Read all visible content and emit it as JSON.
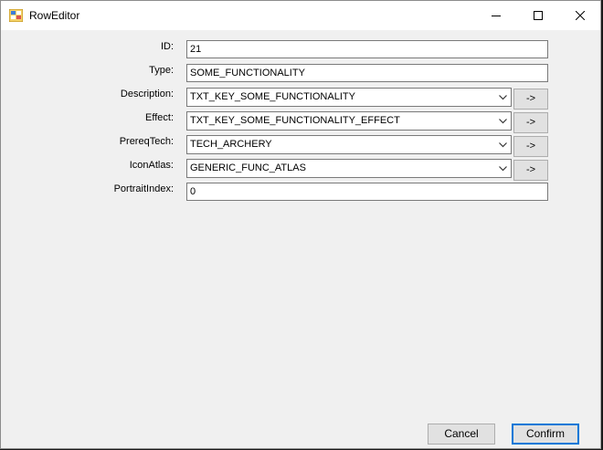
{
  "window": {
    "title": "RowEditor"
  },
  "form": {
    "id": {
      "label": "ID:",
      "value": "21"
    },
    "type": {
      "label": "Type:",
      "value": "SOME_FUNCTIONALITY"
    },
    "description": {
      "label": "Description:",
      "value": "TXT_KEY_SOME_FUNCTIONALITY",
      "go": "->"
    },
    "effect": {
      "label": "Effect:",
      "value": "TXT_KEY_SOME_FUNCTIONALITY_EFFECT",
      "go": "->"
    },
    "prereq_tech": {
      "label": "PrereqTech:",
      "value": "TECH_ARCHERY",
      "go": "->"
    },
    "icon_atlas": {
      "label": "IconAtlas:",
      "value": "GENERIC_FUNC_ATLAS",
      "go": "->"
    },
    "portrait_index": {
      "label": "PortraitIndex:",
      "value": "0"
    }
  },
  "footer": {
    "cancel_label": "Cancel",
    "confirm_label": "Confirm"
  }
}
